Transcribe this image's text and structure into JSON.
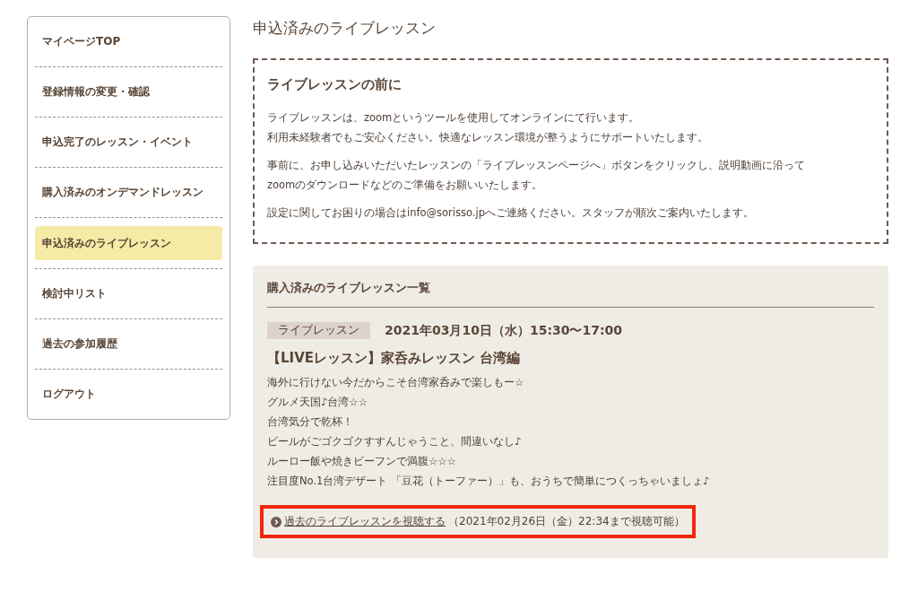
{
  "sidebar": {
    "items": [
      {
        "label": "マイページTOP",
        "selected": false
      },
      {
        "label": "登録情報の変更・確認",
        "selected": false
      },
      {
        "label": "申込完了のレッスン・イベント",
        "selected": false
      },
      {
        "label": "購入済みのオンデマンドレッスン",
        "selected": false
      },
      {
        "label": "申込済みのライブレッスン",
        "selected": true
      },
      {
        "label": "検討中リスト",
        "selected": false
      },
      {
        "label": "過去の参加履歴",
        "selected": false
      },
      {
        "label": "ログアウト",
        "selected": false
      }
    ]
  },
  "page_title": "申込済みのライブレッスン",
  "notice": {
    "title": "ライブレッスンの前に",
    "paragraphs": [
      [
        "ライブレッスンは、zoomというツールを使用してオンラインにて行います。",
        "利用未経験者でもご安心ください。快適なレッスン環境が整うようにサポートいたします。"
      ],
      [
        "事前に、お申し込みいただいたレッスンの「ライブレッスンページへ」ボタンをクリックし、説明動画に沿って",
        "zoomのダウンロードなどのご準備をお願いいたします。"
      ],
      [
        "設定に関してお困りの場合はinfo@sorisso.jpへご連絡ください。スタッフが順次ご案内いたします。"
      ]
    ]
  },
  "lesson_list": {
    "title": "購入済みのライブレッスン一覧",
    "lessons": [
      {
        "tag": "ライブレッスン",
        "datetime": "2021年03月10日（水）15:30〜17:00",
        "name": "【LIVEレッスン】家呑みレッスン 台湾編",
        "description": [
          "海外に行けない今だからこそ台湾家呑みで楽しもー☆",
          "グルメ天国♪台湾☆☆",
          "台湾気分で乾杯！",
          "ビールがごゴクゴクすすんじゃうこと、間違いなし♪",
          "ルーロー飯や焼きビーフンで満腹☆☆☆",
          "注目度No.1台湾デザート 「豆花（トーファー）」も、おうちで簡単につくっちゃいましょ♪"
        ],
        "link": {
          "label": "過去のライブレッスンを視聴する",
          "note": "（2021年02月26日（金）22:34まで視聴可能）",
          "highlighted": true
        }
      }
    ]
  }
}
